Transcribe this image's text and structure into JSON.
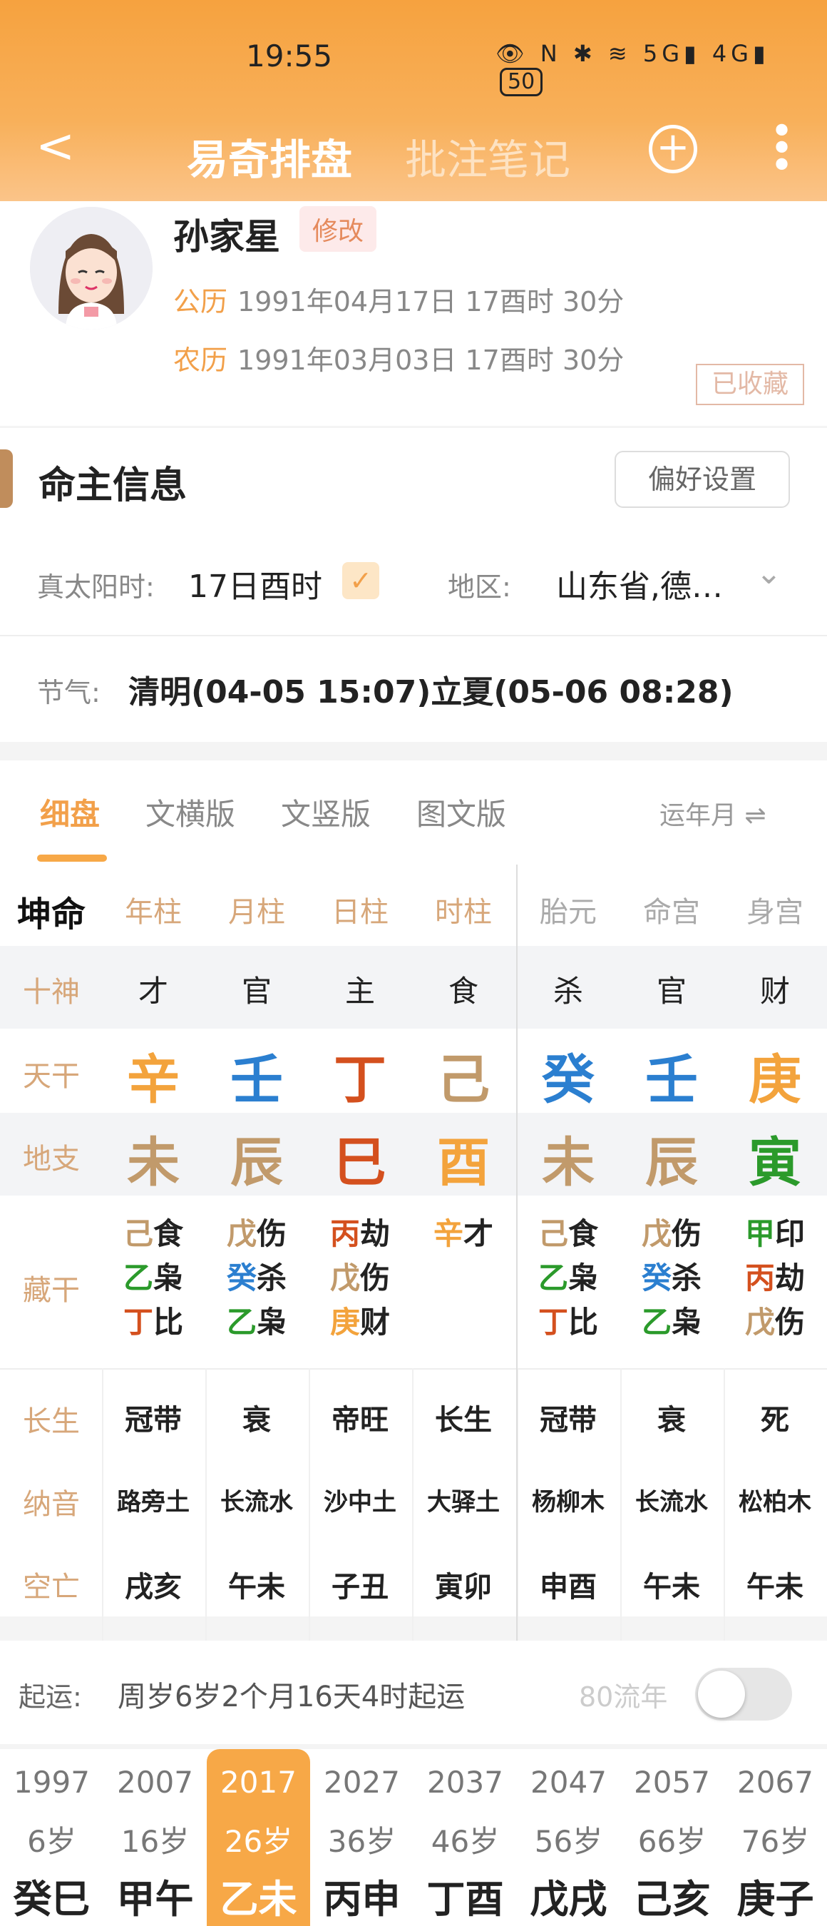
{
  "status_bar": {
    "time": "19:55",
    "icons": "👁 N ✱ ≋ 5G▮ 4G▮",
    "battery": "50"
  },
  "nav": {
    "back": "<",
    "tab_active": "易奇排盘",
    "tab_inactive": "批注笔记",
    "add": "+",
    "more": "⋮"
  },
  "profile": {
    "name": "孙家星",
    "edit_label": "修改",
    "solar_label": "公历",
    "solar_value": "1991年04月17日 17酉时 30分",
    "lunar_label": "农历",
    "lunar_value": "1991年03月03日 17酉时 30分",
    "stamp": "已收藏"
  },
  "owner_info": {
    "title": "命主信息",
    "pref_button": "偏好设置",
    "solar_time_label": "真太阳时:",
    "solar_time_value": "17日酉时",
    "check": "✓",
    "region_label": "地区:",
    "region_value": "山东省,德…",
    "jieqi_label": "节气:",
    "jieqi_value": "清明(04-05 15:07)立夏(05-06 08:28)"
  },
  "chart_tabs": {
    "tabs": [
      "细盘",
      "文横版",
      "文竖版",
      "图文版"
    ],
    "active": "细盘",
    "switch_label": "运年月 ⇌"
  },
  "colors": {
    "accent": "#f2a04a",
    "fire": "#d4501e",
    "water": "#2b7fd0",
    "wood": "#2b9a2b",
    "earth": "#c19a6b",
    "metal": "#f3a33c"
  },
  "grid": {
    "header": {
      "label": "坤命",
      "cols": [
        "年柱",
        "月柱",
        "日柱",
        "时柱",
        "胎元",
        "命宫",
        "身宫"
      ]
    },
    "shishen": {
      "label": "十神",
      "cols": [
        "才",
        "官",
        "主",
        "食",
        "杀",
        "官",
        "财"
      ]
    },
    "tiangan": {
      "label": "天干",
      "cols": [
        "辛",
        "壬",
        "丁",
        "己",
        "癸",
        "壬",
        "庚"
      ]
    },
    "dizhi": {
      "label": "地支",
      "cols": [
        "未",
        "辰",
        "巳",
        "酉",
        "未",
        "辰",
        "寅"
      ]
    },
    "canggan": {
      "label": "藏干",
      "cols": [
        [
          {
            "g": "己",
            "s": "食"
          },
          {
            "g": "乙",
            "s": "枭"
          },
          {
            "g": "丁",
            "s": "比"
          }
        ],
        [
          {
            "g": "戊",
            "s": "伤"
          },
          {
            "g": "癸",
            "s": "杀"
          },
          {
            "g": "乙",
            "s": "枭"
          }
        ],
        [
          {
            "g": "丙",
            "s": "劫"
          },
          {
            "g": "戊",
            "s": "伤"
          },
          {
            "g": "庚",
            "s": "财"
          }
        ],
        [
          {
            "g": "辛",
            "s": "才"
          }
        ],
        [
          {
            "g": "己",
            "s": "食"
          },
          {
            "g": "乙",
            "s": "枭"
          },
          {
            "g": "丁",
            "s": "比"
          }
        ],
        [
          {
            "g": "戊",
            "s": "伤"
          },
          {
            "g": "癸",
            "s": "杀"
          },
          {
            "g": "乙",
            "s": "枭"
          }
        ],
        [
          {
            "g": "甲",
            "s": "印"
          },
          {
            "g": "丙",
            "s": "劫"
          },
          {
            "g": "戊",
            "s": "伤"
          }
        ]
      ]
    },
    "changsheng": {
      "label": "长生",
      "cols": [
        "冠带",
        "衰",
        "帝旺",
        "长生",
        "冠带",
        "衰",
        "死"
      ]
    },
    "nayin": {
      "label": "纳音",
      "cols": [
        "路旁土",
        "长流水",
        "沙中土",
        "大驿土",
        "杨柳木",
        "长流水",
        "松柏木"
      ]
    },
    "kongwang": {
      "label": "空亡",
      "cols": [
        "戌亥",
        "午未",
        "子丑",
        "寅卯",
        "申酉",
        "午未",
        "午未"
      ]
    }
  },
  "qiyun": {
    "label": "起运:",
    "value": "周岁6岁2个月16天4时起运",
    "toggle_label": "80流年"
  },
  "dayun": [
    {
      "year": "1997",
      "age": "6岁",
      "gz": "癸巳"
    },
    {
      "year": "2007",
      "age": "16岁",
      "gz": "甲午"
    },
    {
      "year": "2017",
      "age": "26岁",
      "gz": "乙未"
    },
    {
      "year": "2027",
      "age": "36岁",
      "gz": "丙申"
    },
    {
      "year": "2037",
      "age": "46岁",
      "gz": "丁酉"
    },
    {
      "year": "2047",
      "age": "56岁",
      "gz": "戊戌"
    },
    {
      "year": "2057",
      "age": "66岁",
      "gz": "己亥"
    },
    {
      "year": "2067",
      "age": "76岁",
      "gz": "庚子"
    }
  ],
  "dayun_active_index": 2
}
